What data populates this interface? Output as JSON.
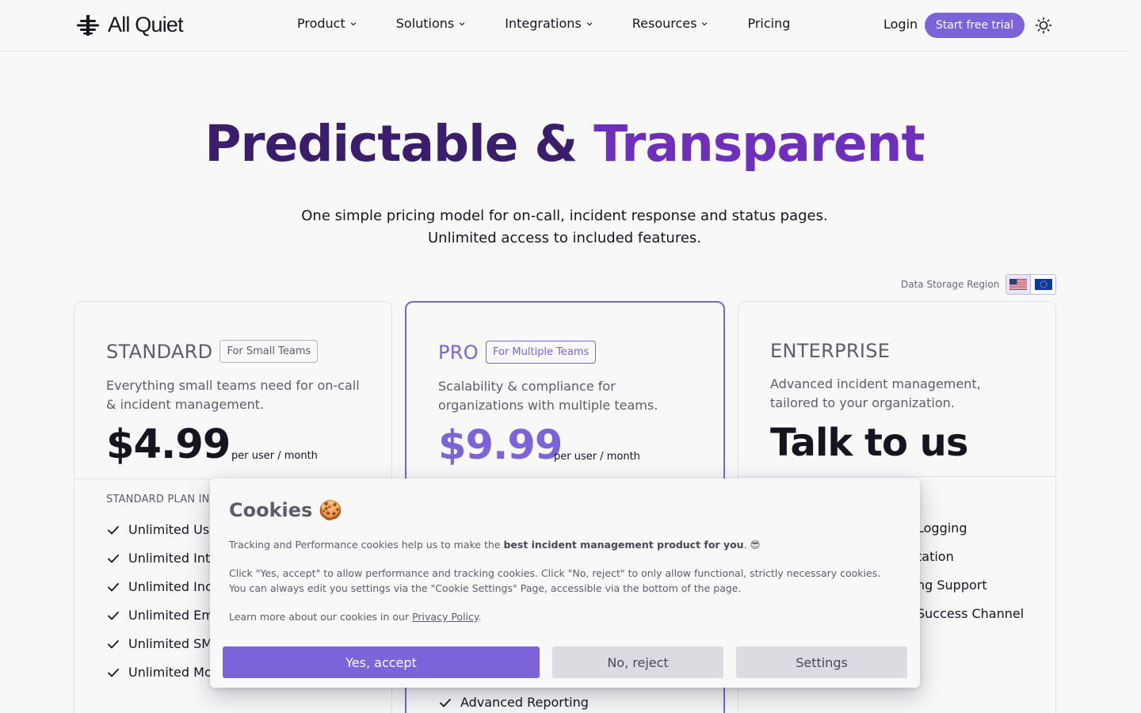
{
  "header": {
    "logo_text": "All Quiet",
    "nav": [
      {
        "label": "Product",
        "has_dropdown": true
      },
      {
        "label": "Solutions",
        "has_dropdown": true
      },
      {
        "label": "Integrations",
        "has_dropdown": true
      },
      {
        "label": "Resources",
        "has_dropdown": true
      },
      {
        "label": "Pricing",
        "has_dropdown": false
      }
    ],
    "login": "Login",
    "cta": "Start free trial",
    "theme_icon": "sun-icon"
  },
  "hero": {
    "title_part1": "Predictable &",
    "title_part2": "Transparent",
    "subtitle_line1": "One simple pricing model for on-call, incident response and status pages.",
    "subtitle_line2": "Unlimited access to included features."
  },
  "region": {
    "label": "Data Storage Region",
    "options": [
      "US",
      "EU"
    ],
    "selected": "US"
  },
  "plans": {
    "standard": {
      "name": "STANDARD",
      "tag": "For Small Teams",
      "desc": "Everything small teams need for on-call & incident management.",
      "price": "$4.99",
      "per": "per user / month",
      "includes_heading": "STANDARD PLAN IN",
      "features": [
        "Unlimited Use",
        "Unlimited Inte",
        "Unlimited Inci",
        "Unlimited Ema",
        "Unlimited SMS",
        "Unlimited Mor"
      ]
    },
    "pro": {
      "name": "PRO",
      "tag": "For Multiple Teams",
      "desc": "Scalability & compliance for organizations with multiple teams.",
      "price": "$9.99",
      "per": "per user / month",
      "features": [
        "Advanced Reporting"
      ]
    },
    "enterprise": {
      "name": "ENTERPRISE",
      "desc": "Advanced incident management, tailored to your organization.",
      "price": "Talk to us",
      "features": [
        "Logging",
        "tation",
        "ng Support",
        "Success Channel"
      ]
    }
  },
  "cookie": {
    "title": "Cookies",
    "emoji": "🍪",
    "p1_pre": "Tracking and Performance cookies help us to make the ",
    "p1_bold": "best incident management product for you",
    "p1_post": ". 😎",
    "p2": "Click \"Yes, accept\" to allow performance and tracking cookies. Click \"No, reject\" to only allow functional, strictly necessary cookies. You can always edit you settings via the \"Cookie Settings\" Page, accessible via the bottom of the page.",
    "p3_pre": "Learn more about our cookies in our ",
    "p3_link": "Privacy Policy",
    "p3_post": ".",
    "accept": "Yes, accept",
    "reject": "No, reject",
    "settings": "Settings"
  },
  "colors": {
    "accent": "#7c63d9",
    "title_dark": "#3a1d6b",
    "title_purple": "#6f2fbd"
  }
}
